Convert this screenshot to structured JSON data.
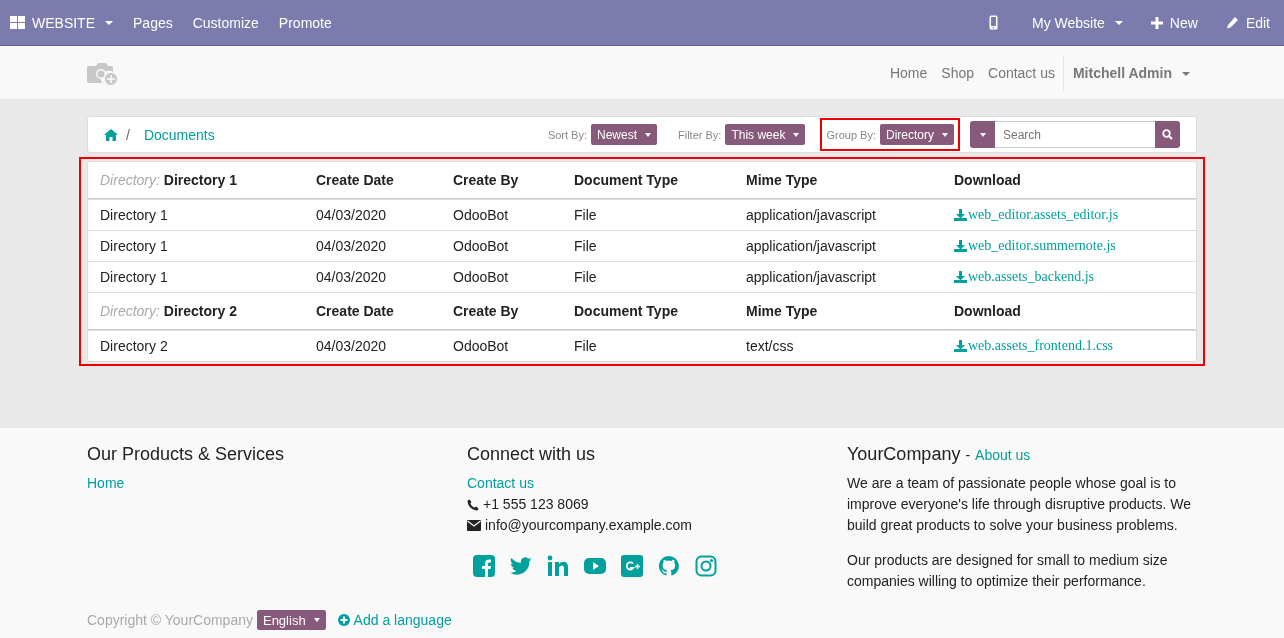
{
  "top_bar": {
    "apps_menu": "WEBSITE",
    "items": [
      "Pages",
      "Customize",
      "Promote"
    ],
    "website_menu": "My Website",
    "new_button": "New",
    "edit_button": "Edit"
  },
  "header": {
    "nav": [
      "Home",
      "Shop",
      "Contact us"
    ],
    "user_menu": "Mitchell Admin"
  },
  "breadcrumb": {
    "separator": "/",
    "current": "Documents"
  },
  "filters": [
    {
      "label": "Sort By:",
      "value": "Newest",
      "highlighted": false
    },
    {
      "label": "Filter By:",
      "value": "This week",
      "highlighted": false
    },
    {
      "label": "Group By:",
      "value": "Directory",
      "highlighted": true
    }
  ],
  "search": {
    "placeholder": "Search"
  },
  "table": {
    "highlighted": true,
    "groups": [
      {
        "columns": [
          "*Directory:* Directory 1",
          "Create Date",
          "Create By",
          "Document Type",
          "Mime Type",
          "Download"
        ],
        "rows": [
          [
            "Directory 1",
            "04/03/2020",
            "OdooBot",
            "File",
            "application/javascript",
            "web_editor.assets_editor.js"
          ],
          [
            "Directory 1",
            "04/03/2020",
            "OdooBot",
            "File",
            "application/javascript",
            "web_editor.summernote.js"
          ],
          [
            "Directory 1",
            "04/03/2020",
            "OdooBot",
            "File",
            "application/javascript",
            "web.assets_backend.js"
          ]
        ]
      },
      {
        "columns": [
          "*Directory:* Directory 2",
          "Create Date",
          "Create By",
          "Document Type",
          "Mime Type",
          "Download"
        ],
        "rows": [
          [
            "Directory 2",
            "04/03/2020",
            "OdooBot",
            "File",
            "text/css",
            "web.assets_frontend.1.css"
          ]
        ]
      }
    ]
  },
  "footer": {
    "products_title": "Our Products & Services",
    "products_links": [
      "Home"
    ],
    "connect_title": "Connect with us",
    "connect_link": "Contact us",
    "phone": "+1 555 123 8069",
    "email": "info@yourcompany.example.com",
    "company_name": "YourCompany",
    "company_separator": "-",
    "about_link": "About us",
    "paragraphs": [
      "We are a team of passionate people whose goal is to improve everyone's life through disruptive products. We build great products to solve your business problems.",
      "Our products are designed for small to medium size companies willing to optimize their performance."
    ],
    "copyright": "Copyright © YourCompany",
    "language": "English",
    "add_language": "Add a language"
  }
}
